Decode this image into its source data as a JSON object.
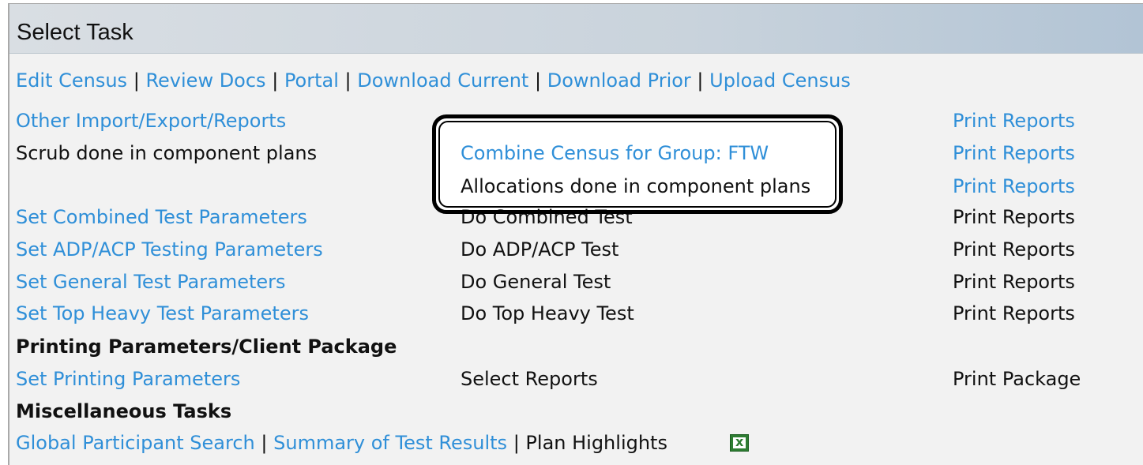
{
  "header": {
    "title": "Select Task"
  },
  "nav_links": [
    "Edit Census",
    "Review Docs",
    "Portal",
    "Download Current",
    "Download Prior",
    "Upload Census"
  ],
  "rows": {
    "other_import": "Other Import/Export/Reports",
    "print_reports_1": "Print Reports",
    "scrub": "Scrub done in component plans",
    "combine": "Combine Census for Group: FTW",
    "print_reports_2": "Print Reports",
    "allocations": "Allocations done in component plans",
    "print_reports_3": "Print Reports",
    "set_combined": "Set Combined Test Parameters",
    "do_combined": "Do Combined Test",
    "print_reports_4": "Print Reports",
    "set_adp": "Set ADP/ACP Testing Parameters",
    "do_adp": "Do ADP/ACP Test",
    "print_reports_5": "Print Reports",
    "set_general": "Set General Test Parameters",
    "do_general": "Do General Test",
    "print_reports_6": "Print Reports",
    "set_topheavy": "Set Top Heavy Test Parameters",
    "do_topheavy": "Do Top Heavy Test",
    "print_reports_7": "Print Reports"
  },
  "printing": {
    "heading": "Printing Parameters/Client Package",
    "set_printing": "Set Printing Parameters",
    "select_reports": "Select Reports",
    "print_package": "Print Package"
  },
  "misc": {
    "heading": "Miscellaneous Tasks",
    "global_search": "Global Participant Search",
    "summary": "Summary of Test Results",
    "plan_highlights": "Plan Highlights",
    "excel_icon": "excel-icon"
  },
  "separator": "|",
  "colors": {
    "link": "#2f8fd8",
    "callout": "#000000"
  }
}
